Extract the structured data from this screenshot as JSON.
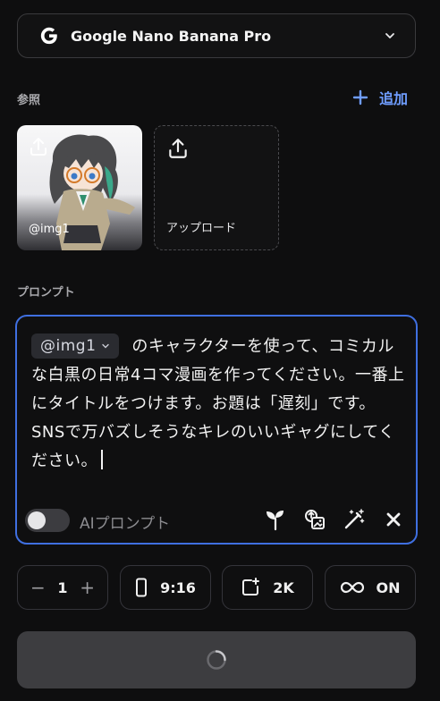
{
  "model_selector": {
    "name": "Google Nano Banana Pro",
    "logo_icon": "google-g-icon",
    "chevron_icon": "chevron-down-icon"
  },
  "reference": {
    "label": "参照",
    "add_label": "追加",
    "images": [
      {
        "tag": "@img1"
      }
    ],
    "upload_label": "アップロード"
  },
  "prompt": {
    "label": "プロンプト",
    "mention": "@img1",
    "text": "のキャラクターを使って、コミカルな白黒の日常4コマ漫画を作ってください。一番上にタイトルをつけます。お題は「遅刻」です。SNSで万バズしそうなキレのいいギャグにしてください。",
    "ai_prompt_label": "AIプロンプト",
    "ai_prompt_on": false,
    "tools": [
      "sprout-icon",
      "image-swap-icon",
      "magic-wand-icon",
      "clear-icon"
    ]
  },
  "controls": {
    "count": "1",
    "count_minus": "−",
    "count_plus": "+",
    "aspect_ratio": "9:16",
    "resolution": "2K",
    "loop": "ON"
  },
  "colors": {
    "accent": "#3f6fe0",
    "link": "#6f9dff",
    "background": "#0e0e0f"
  }
}
